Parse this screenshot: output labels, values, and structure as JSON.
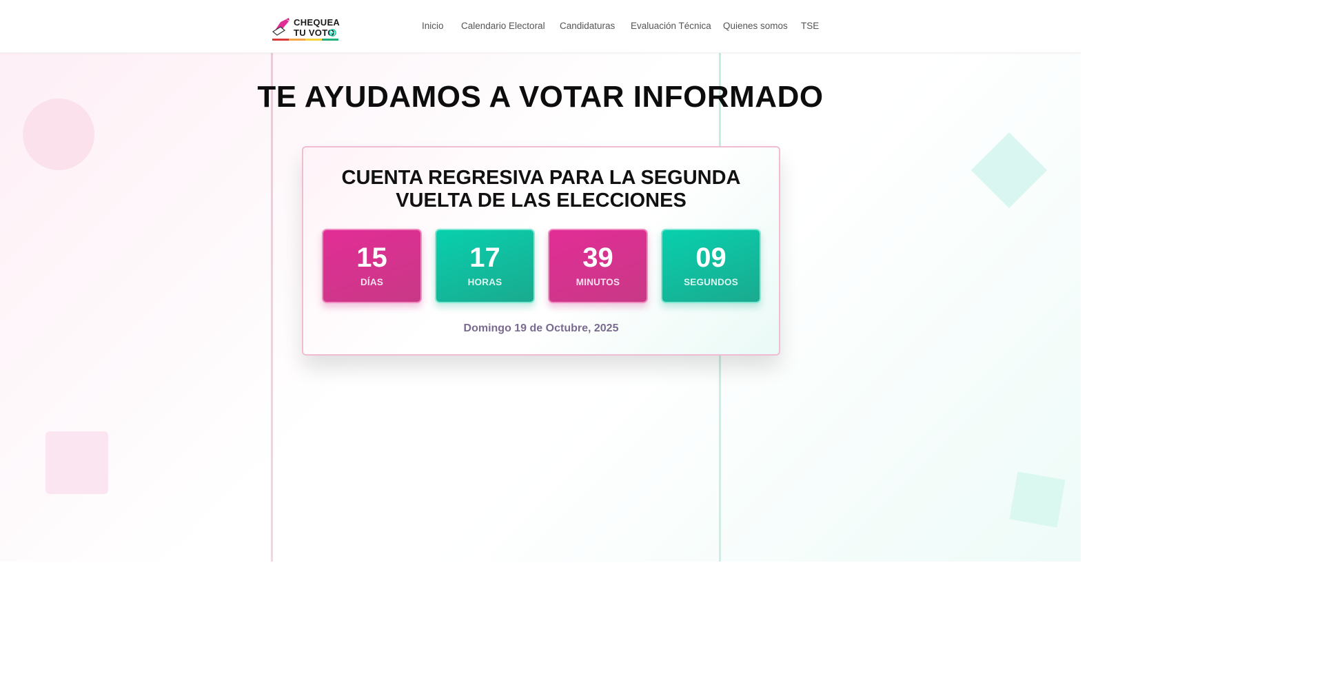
{
  "logo": {
    "text": "CHEQUEA\nTU VOTO",
    "bar_colors": [
      "#d93a3a",
      "#f2a541",
      "#f5d13b",
      "#20b27a"
    ],
    "pink": "#e22d96",
    "teal": "#14c9a4"
  },
  "nav": {
    "items": [
      "Inicio",
      "Calendario Electoral",
      "Candidaturas",
      "Evaluación Técnica",
      "Quienes somos",
      "TSE"
    ]
  },
  "hero": {
    "title": "TE AYUDAMOS A VOTAR INFORMADO"
  },
  "countdown": {
    "title_line1": "CUENTA REGRESIVA PARA LA SEGUNDA",
    "title_line2": "VUELTA DE LAS ELECCIONES",
    "boxes": [
      {
        "value": "15",
        "label": "DÍAS",
        "color": "pink"
      },
      {
        "value": "17",
        "label": "HORAS",
        "color": "teal"
      },
      {
        "value": "39",
        "label": "MINUTOS",
        "color": "pink"
      },
      {
        "value": "09",
        "label": "SEGUNDOS",
        "color": "teal"
      }
    ],
    "date": "Domingo 19 de Octubre, 2025"
  },
  "colors": {
    "accent_pink": "#e22d96",
    "accent_teal": "#08d0ad",
    "date_text": "#7a6a8f"
  }
}
